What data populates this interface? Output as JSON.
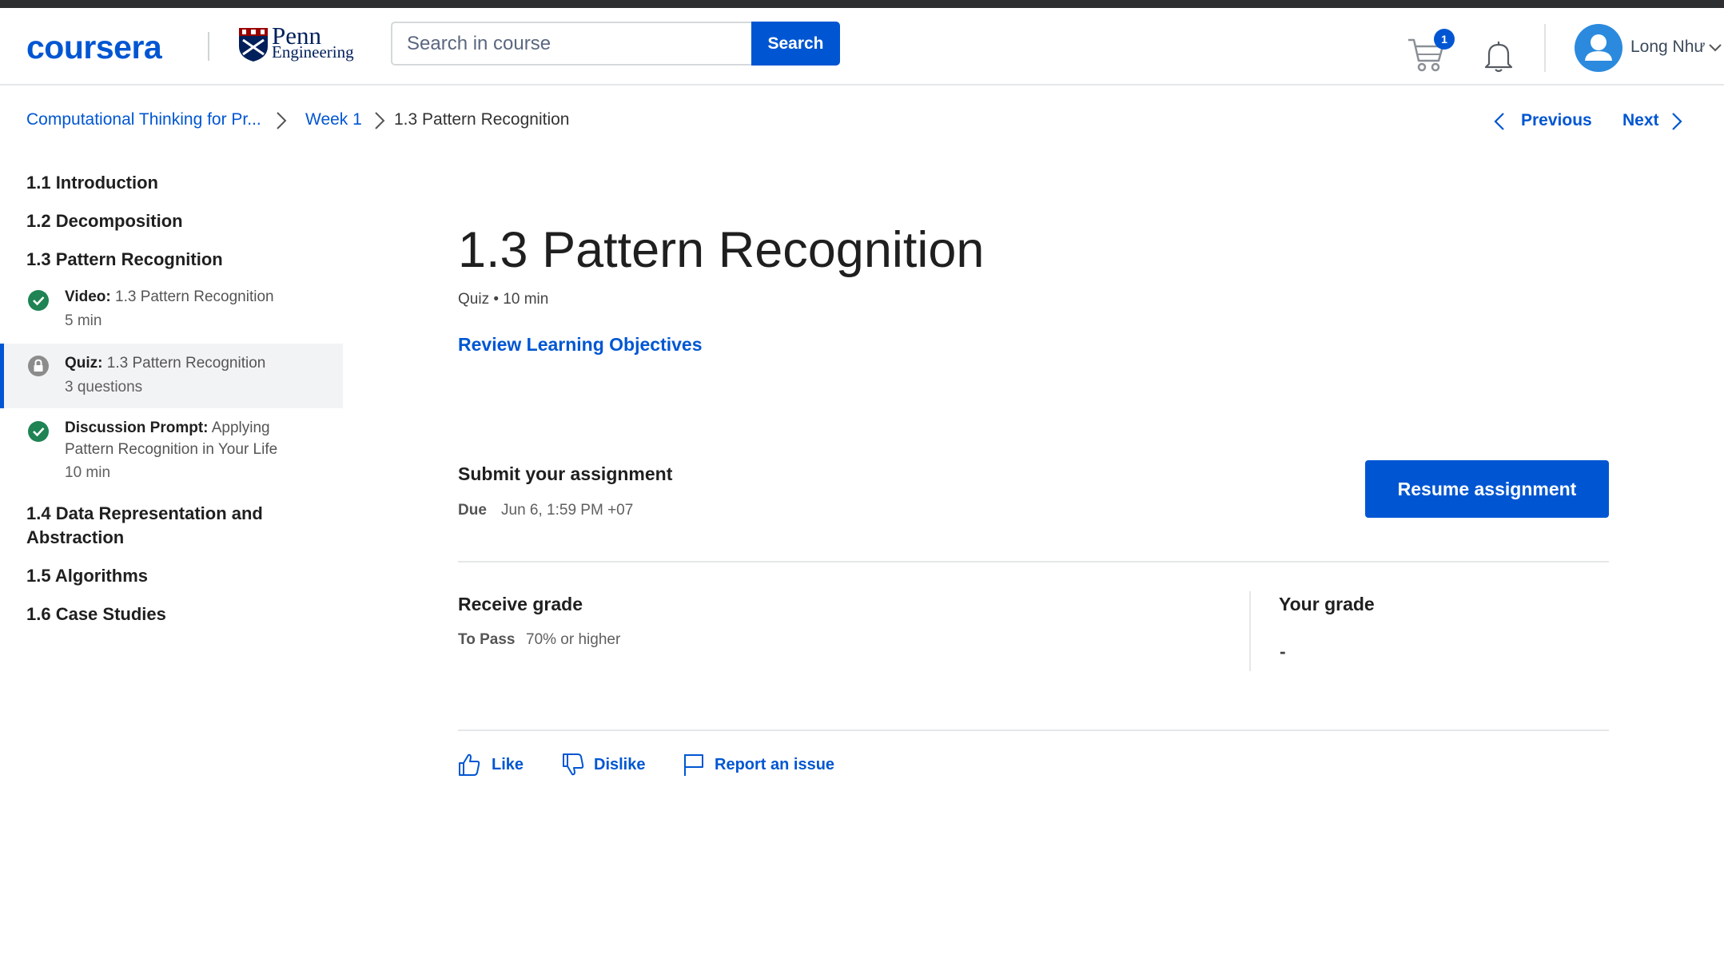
{
  "brand": {
    "logo_text": "coursera",
    "partner_line1": "Penn",
    "partner_line2": "Engineering"
  },
  "search": {
    "placeholder": "Search in course",
    "button_label": "Search"
  },
  "header": {
    "cart_count": "1",
    "user_name": "Long Như"
  },
  "breadcrumb": {
    "course": "Computational Thinking for Pr...",
    "week": "Week 1",
    "current": "1.3 Pattern Recognition"
  },
  "nav": {
    "previous": "Previous",
    "next": "Next"
  },
  "sidebar": {
    "weeks": [
      "1.1 Introduction",
      "1.2 Decomposition",
      "1.3 Pattern Recognition",
      "1.4 Data Representation and Abstraction",
      "1.5 Algorithms",
      "1.6 Case Studies"
    ],
    "items": [
      {
        "type": "Video:",
        "title": "1.3 Pattern Recognition",
        "meta": "5 min",
        "status": "completed"
      },
      {
        "type": "Quiz:",
        "title": "1.3 Pattern Recognition",
        "meta": "3 questions",
        "status": "locked"
      },
      {
        "type": "Discussion Prompt:",
        "title": "Applying Pattern Recognition in Your Life",
        "meta": "10 min",
        "status": "completed"
      }
    ]
  },
  "main": {
    "title": "1.3 Pattern Recognition",
    "subtitle": "Quiz • 10 min",
    "review_link": "Review Learning Objectives",
    "submit_heading": "Submit your assignment",
    "due_label": "Due",
    "due_value": "Jun 6, 1:59 PM +07",
    "resume_button": "Resume assignment",
    "receive_heading": "Receive grade",
    "to_pass_label": "To Pass",
    "to_pass_value": "70% or higher",
    "your_grade_heading": "Your grade",
    "your_grade_value": "-"
  },
  "feedback": {
    "like": "Like",
    "dislike": "Dislike",
    "report": "Report an issue"
  },
  "colors": {
    "accent": "#0056d2",
    "completed": "#1f8354",
    "locked": "#8c8c8c"
  }
}
